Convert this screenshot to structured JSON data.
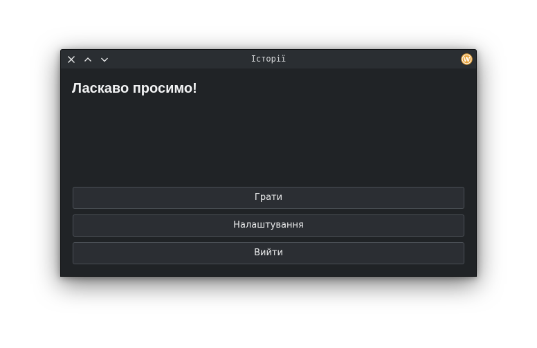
{
  "window": {
    "title": "Історії",
    "controls": [
      {
        "name": "close",
        "icon": "close-icon"
      },
      {
        "name": "maximize",
        "icon": "chevron-up-icon"
      },
      {
        "name": "minimize",
        "icon": "chevron-down-icon"
      }
    ],
    "app_icon": "w-badge-icon",
    "app_icon_letter": "W"
  },
  "main": {
    "heading": "Ласкаво просимо!",
    "buttons": [
      {
        "label": "Грати"
      },
      {
        "label": "Налаштування"
      },
      {
        "label": "Вийти"
      }
    ]
  },
  "colors": {
    "window_bg": "#202326",
    "titlebar_bg": "#2a2e32",
    "button_bg": "#2b2e33",
    "button_border": "#4a4f55",
    "app_icon_accent": "#e8a33b"
  }
}
